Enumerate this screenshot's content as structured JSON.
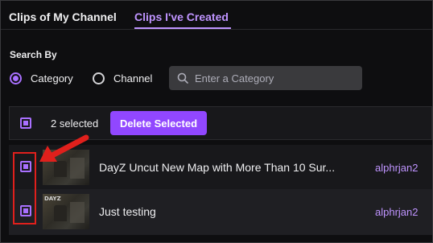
{
  "tabs": [
    {
      "label": "Clips of My Channel",
      "active": false
    },
    {
      "label": "Clips I've Created",
      "active": true
    }
  ],
  "search_by": {
    "label": "Search By",
    "options": [
      {
        "label": "Category",
        "selected": true
      },
      {
        "label": "Channel",
        "selected": false
      }
    ],
    "input_placeholder": "Enter a Category"
  },
  "toolbar": {
    "selected_count": "2 selected",
    "delete_label": "Delete Selected",
    "select_all_checked": true
  },
  "clips": [
    {
      "title": "DayZ Uncut New Map with More Than 10 Sur...",
      "creator": "alphrjan2",
      "checked": true,
      "thumb_tag": ""
    },
    {
      "title": "Just testing",
      "creator": "alphrjan2",
      "checked": true,
      "thumb_tag": "DAYZ"
    }
  ],
  "colors": {
    "accent": "#a970ff",
    "accent_text": "#bf94ff",
    "button": "#9147ff",
    "annotation": "#e0201c",
    "background": "#0e0e10"
  },
  "icons": {
    "search": "search-icon",
    "annotation_arrow": "arrow-icon"
  }
}
